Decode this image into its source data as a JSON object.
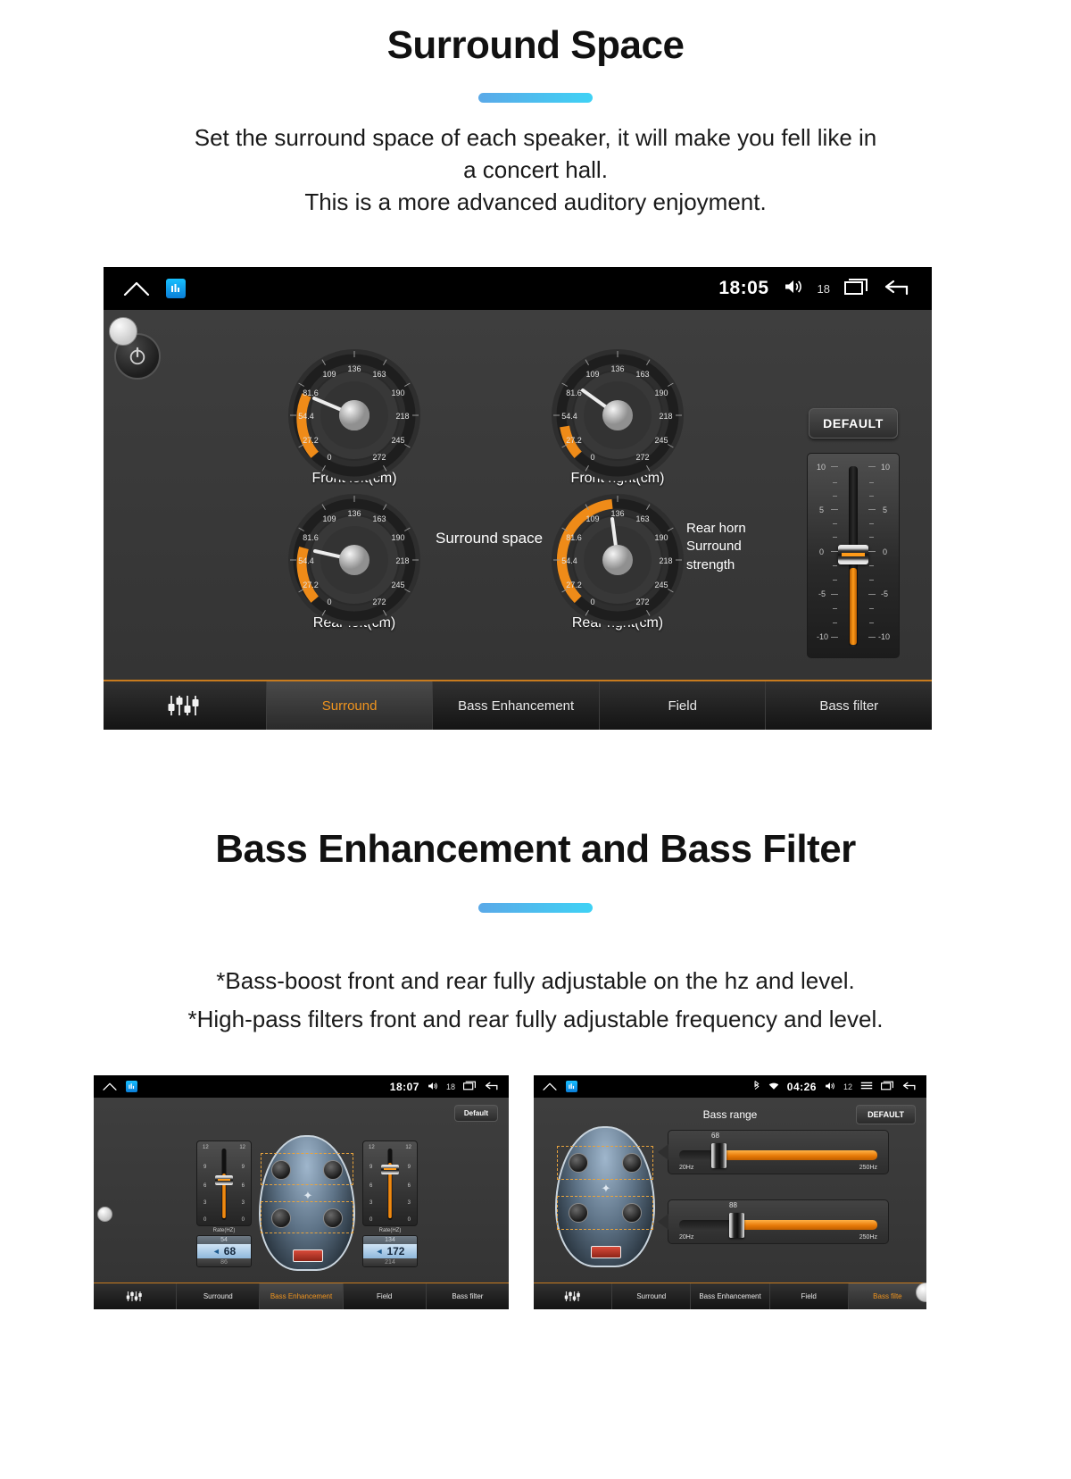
{
  "sections": [
    {
      "title": "Surround Space",
      "desc_lines": [
        "Set the surround space of each speaker, it will make you fell like in",
        "a concert hall.",
        "This is a more advanced auditory enjoyment."
      ]
    },
    {
      "title": "Bass Enhancement and Bass Filter",
      "desc_lines": [
        "*Bass-boost front and rear fully adjustable on the hz and level.",
        "*High-pass filters front and rear fully adjustable frequency and level."
      ]
    }
  ],
  "accent_color": "#3fd2f5",
  "highlight_color": "#f0941e",
  "surround_screen": {
    "statusbar": {
      "home_icon": "home-icon",
      "app_icon": "equalizer-app-icon",
      "time": "18:05",
      "volume_icon": "volume-icon",
      "volume_value": "18",
      "recents_icon": "recents-icon",
      "back_icon": "back-icon"
    },
    "default_button": "DEFAULT",
    "center_label": "Surround space",
    "fader_label_lines": [
      "Rear horn",
      "Surround",
      "strength"
    ],
    "fader_ticks": [
      "10",
      "5",
      "0",
      "-5",
      "-10"
    ],
    "gauge_ticks": [
      "0",
      "27.2",
      "54.4",
      "81.6",
      "109",
      "136",
      "163",
      "190",
      "218",
      "245",
      "272"
    ],
    "gauges": [
      {
        "label": "Front left(cm)",
        "value": 52
      },
      {
        "label": "Front right(cm)",
        "value": 28
      },
      {
        "label": "Rear left(cm)",
        "value": 44
      },
      {
        "label": "Rear right(cm)",
        "value": 95
      }
    ],
    "tabs": [
      {
        "label": "",
        "icon": "equalizer-icon",
        "active": false
      },
      {
        "label": "Surround",
        "active": true
      },
      {
        "label": "Bass Enhancement",
        "active": false
      },
      {
        "label": "Field",
        "active": false
      },
      {
        "label": "Bass filter",
        "active": false
      }
    ]
  },
  "bass_enhancement_screen": {
    "statusbar": {
      "time": "18:07",
      "volume_value": "18"
    },
    "default_button": "Default",
    "columns": [
      {
        "rate_label": "Rate(HZ)",
        "value_top": "54",
        "value_main": "68",
        "value_bottom": "86",
        "scale": [
          "12",
          "9",
          "6",
          "3",
          "0"
        ]
      },
      {
        "rate_label": "Rate(HZ)",
        "value_top": "134",
        "value_main": "172",
        "value_bottom": "214",
        "scale": [
          "12",
          "9",
          "6",
          "3",
          "0"
        ]
      }
    ],
    "tabs": [
      {
        "label": "",
        "icon": "equalizer-icon",
        "active": false
      },
      {
        "label": "Surround",
        "active": false
      },
      {
        "label": "Bass Enhancement",
        "active": true
      },
      {
        "label": "Field",
        "active": false
      },
      {
        "label": "Bass filter",
        "active": false
      }
    ]
  },
  "bass_filter_screen": {
    "statusbar": {
      "bluetooth_icon": "bluetooth-icon",
      "wifi_icon": "wifi-icon",
      "time": "04:26",
      "volume_value": "12",
      "menu_icon": "menu-icon"
    },
    "default_button": "DEFAULT",
    "title": "Bass range",
    "sliders": [
      {
        "value": "68",
        "min": "20Hz",
        "max": "250Hz",
        "percent": 19
      },
      {
        "value": "88",
        "min": "20Hz",
        "max": "250Hz",
        "percent": 26
      }
    ],
    "tabs": [
      {
        "label": "",
        "icon": "equalizer-icon",
        "active": false
      },
      {
        "label": "Surround",
        "active": false
      },
      {
        "label": "Bass Enhancement",
        "active": false
      },
      {
        "label": "Field",
        "active": false
      },
      {
        "label": "Bass filte",
        "active": true
      }
    ]
  }
}
